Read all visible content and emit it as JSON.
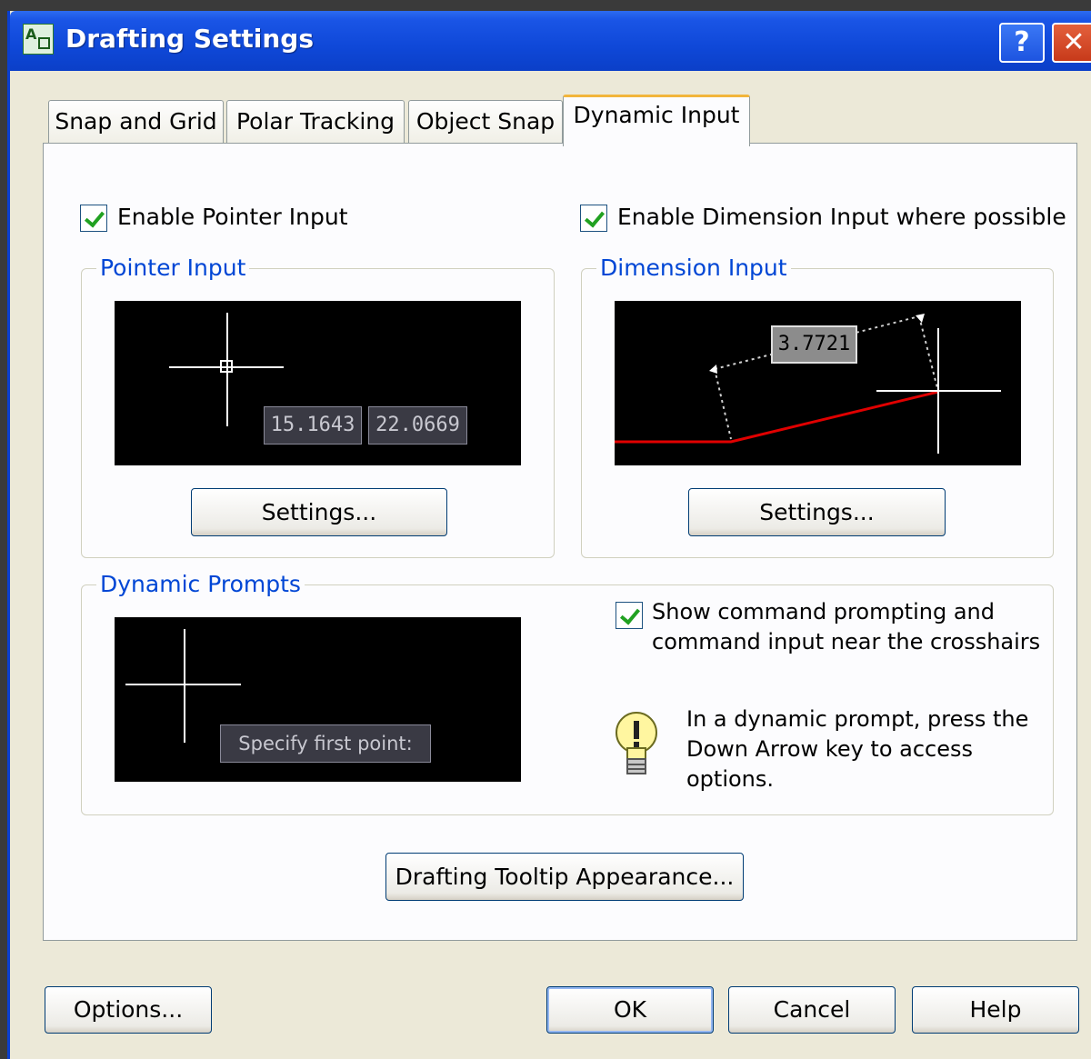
{
  "window": {
    "title": "Drafting Settings"
  },
  "titlebar": {
    "help_label": "?",
    "close_label": "✕"
  },
  "tabs": [
    {
      "label": "Snap and Grid"
    },
    {
      "label": "Polar Tracking"
    },
    {
      "label": "Object Snap"
    },
    {
      "label": "Dynamic Input",
      "active": true
    }
  ],
  "options": {
    "enable_pointer_input": {
      "label": "Enable Pointer Input",
      "checked": true
    },
    "enable_dimension_input": {
      "label": "Enable Dimension Input where possible",
      "checked": true
    }
  },
  "pointer_input": {
    "title": "Pointer Input",
    "coord_x": "15.1643",
    "coord_y": "22.0669",
    "settings_label": "Settings..."
  },
  "dimension_input": {
    "title": "Dimension Input",
    "value": "3.7721",
    "settings_label": "Settings..."
  },
  "dynamic_prompts": {
    "title": "Dynamic Prompts",
    "prompt_text": "Specify first point:",
    "show_prompting": {
      "line1": "Show command prompting and",
      "line2": "command input near the crosshairs",
      "checked": true
    },
    "hint": {
      "line1": "In a dynamic prompt, press the",
      "line2": "Down Arrow key to access",
      "line3": "options."
    }
  },
  "tooltip_button_label": "Drafting Tooltip Appearance...",
  "footer": {
    "options_label": "Options...",
    "ok_label": "OK",
    "cancel_label": "Cancel",
    "help_label": "Help"
  },
  "colors": {
    "title_bar": "#0b3fc8",
    "group_title": "#0046d5",
    "active_tab_accent": "#f2b53b",
    "check_mark": "#21a121",
    "dimension_line": "#e00000"
  }
}
